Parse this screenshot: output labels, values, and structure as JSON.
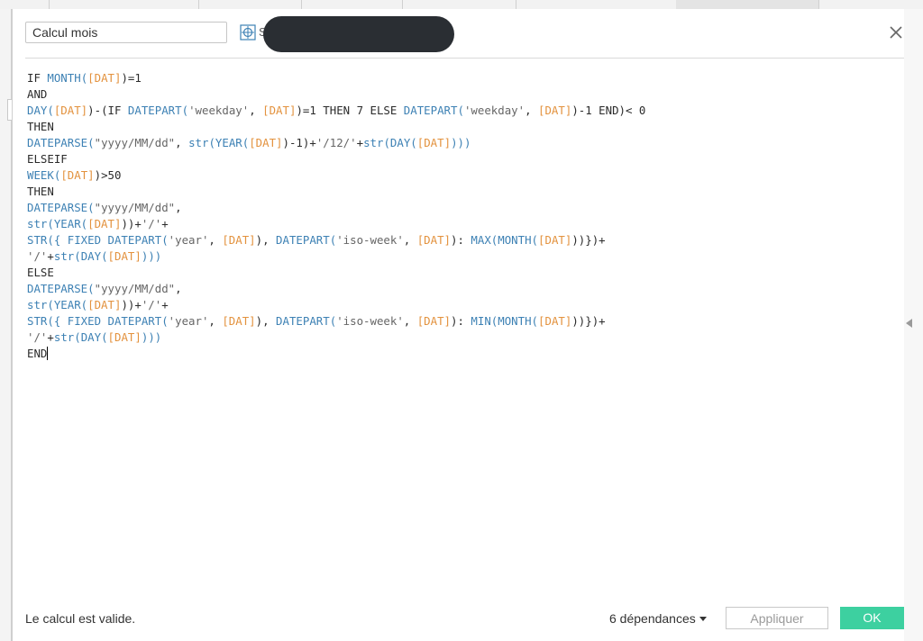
{
  "dialog": {
    "calculation_name": "Calcul mois",
    "datasource_tail": "S",
    "close_icon": "close-icon",
    "datasource_icon": "datasource-icon"
  },
  "editor": {
    "lines": [
      [
        {
          "t": "IF ",
          "c": "kw"
        },
        {
          "t": "MONTH(",
          "c": "fn"
        },
        {
          "t": "[DAT]",
          "c": "fld"
        },
        {
          "t": ")=1",
          "c": "txt"
        }
      ],
      [
        {
          "t": "AND",
          "c": "kw"
        }
      ],
      [
        {
          "t": "DAY(",
          "c": "fn"
        },
        {
          "t": "[DAT]",
          "c": "fld"
        },
        {
          "t": ")-(IF ",
          "c": "txt"
        },
        {
          "t": "DATEPART(",
          "c": "fn"
        },
        {
          "t": "'weekday'",
          "c": "str"
        },
        {
          "t": ", ",
          "c": "txt"
        },
        {
          "t": "[DAT]",
          "c": "fld"
        },
        {
          "t": ")=1 THEN 7 ELSE ",
          "c": "txt"
        },
        {
          "t": "DATEPART(",
          "c": "fn"
        },
        {
          "t": "'weekday'",
          "c": "str"
        },
        {
          "t": ", ",
          "c": "txt"
        },
        {
          "t": "[DAT]",
          "c": "fld"
        },
        {
          "t": ")-1 END)< 0",
          "c": "txt"
        }
      ],
      [
        {
          "t": "THEN",
          "c": "kw"
        }
      ],
      [
        {
          "t": "DATEPARSE(",
          "c": "fn"
        },
        {
          "t": "\"yyyy/MM/dd\"",
          "c": "str"
        },
        {
          "t": ", ",
          "c": "txt"
        },
        {
          "t": "str(YEAR(",
          "c": "fn"
        },
        {
          "t": "[DAT]",
          "c": "fld"
        },
        {
          "t": ")-1)+",
          "c": "txt"
        },
        {
          "t": "'/12/'",
          "c": "str"
        },
        {
          "t": "+",
          "c": "txt"
        },
        {
          "t": "str(DAY(",
          "c": "fn"
        },
        {
          "t": "[DAT]",
          "c": "fld"
        },
        {
          "t": ")))",
          "c": "fn"
        }
      ],
      [
        {
          "t": "ELSEIF",
          "c": "kw"
        }
      ],
      [
        {
          "t": "WEEK(",
          "c": "fn"
        },
        {
          "t": "[DAT]",
          "c": "fld"
        },
        {
          "t": ")>50",
          "c": "txt"
        }
      ],
      [
        {
          "t": "THEN",
          "c": "kw"
        }
      ],
      [
        {
          "t": "DATEPARSE(",
          "c": "fn"
        },
        {
          "t": "\"yyyy/MM/dd\"",
          "c": "str"
        },
        {
          "t": ",",
          "c": "txt"
        }
      ],
      [
        {
          "t": "str(YEAR(",
          "c": "fn"
        },
        {
          "t": "[DAT]",
          "c": "fld"
        },
        {
          "t": "))+",
          "c": "txt"
        },
        {
          "t": "'/'",
          "c": "str"
        },
        {
          "t": "+",
          "c": "txt"
        }
      ],
      [
        {
          "t": "STR({ FIXED DATEPART(",
          "c": "fn"
        },
        {
          "t": "'year'",
          "c": "str"
        },
        {
          "t": ", ",
          "c": "txt"
        },
        {
          "t": "[DAT]",
          "c": "fld"
        },
        {
          "t": "), ",
          "c": "txt"
        },
        {
          "t": "DATEPART(",
          "c": "fn"
        },
        {
          "t": "'iso-week'",
          "c": "str"
        },
        {
          "t": ", ",
          "c": "txt"
        },
        {
          "t": "[DAT]",
          "c": "fld"
        },
        {
          "t": "): ",
          "c": "txt"
        },
        {
          "t": "MAX(MONTH(",
          "c": "fn"
        },
        {
          "t": "[DAT]",
          "c": "fld"
        },
        {
          "t": "))})+",
          "c": "txt"
        }
      ],
      [
        {
          "t": "'/'",
          "c": "str"
        },
        {
          "t": "+",
          "c": "txt"
        },
        {
          "t": "str(DAY(",
          "c": "fn"
        },
        {
          "t": "[DAT]",
          "c": "fld"
        },
        {
          "t": ")))",
          "c": "fn"
        }
      ],
      [
        {
          "t": "ELSE",
          "c": "kw"
        }
      ],
      [
        {
          "t": "DATEPARSE(",
          "c": "fn"
        },
        {
          "t": "\"yyyy/MM/dd\"",
          "c": "str"
        },
        {
          "t": ",",
          "c": "txt"
        }
      ],
      [
        {
          "t": "str(YEAR(",
          "c": "fn"
        },
        {
          "t": "[DAT]",
          "c": "fld"
        },
        {
          "t": "))+",
          "c": "txt"
        },
        {
          "t": "'/'",
          "c": "str"
        },
        {
          "t": "+",
          "c": "txt"
        }
      ],
      [
        {
          "t": "STR({ FIXED DATEPART(",
          "c": "fn"
        },
        {
          "t": "'year'",
          "c": "str"
        },
        {
          "t": ", ",
          "c": "txt"
        },
        {
          "t": "[DAT]",
          "c": "fld"
        },
        {
          "t": "), ",
          "c": "txt"
        },
        {
          "t": "DATEPART(",
          "c": "fn"
        },
        {
          "t": "'iso-week'",
          "c": "str"
        },
        {
          "t": ", ",
          "c": "txt"
        },
        {
          "t": "[DAT]",
          "c": "fld"
        },
        {
          "t": "): ",
          "c": "txt"
        },
        {
          "t": "MIN(MONTH(",
          "c": "fn"
        },
        {
          "t": "[DAT]",
          "c": "fld"
        },
        {
          "t": "))})+",
          "c": "txt"
        }
      ],
      [
        {
          "t": "'/'",
          "c": "str"
        },
        {
          "t": "+",
          "c": "txt"
        },
        {
          "t": "str(DAY(",
          "c": "fn"
        },
        {
          "t": "[DAT]",
          "c": "fld"
        },
        {
          "t": ")))",
          "c": "fn"
        }
      ],
      [
        {
          "t": "END",
          "c": "kw"
        }
      ]
    ],
    "colors": {
      "keyword": "#2b2b2b",
      "function": "#3d81b4",
      "field": "#e3923e",
      "string": "#666666"
    }
  },
  "footer": {
    "status": "Le calcul est valide.",
    "dependencies": "6 dépendances",
    "apply_label": "Appliquer",
    "ok_label": "OK",
    "ok_color": "#3dd0a0"
  }
}
